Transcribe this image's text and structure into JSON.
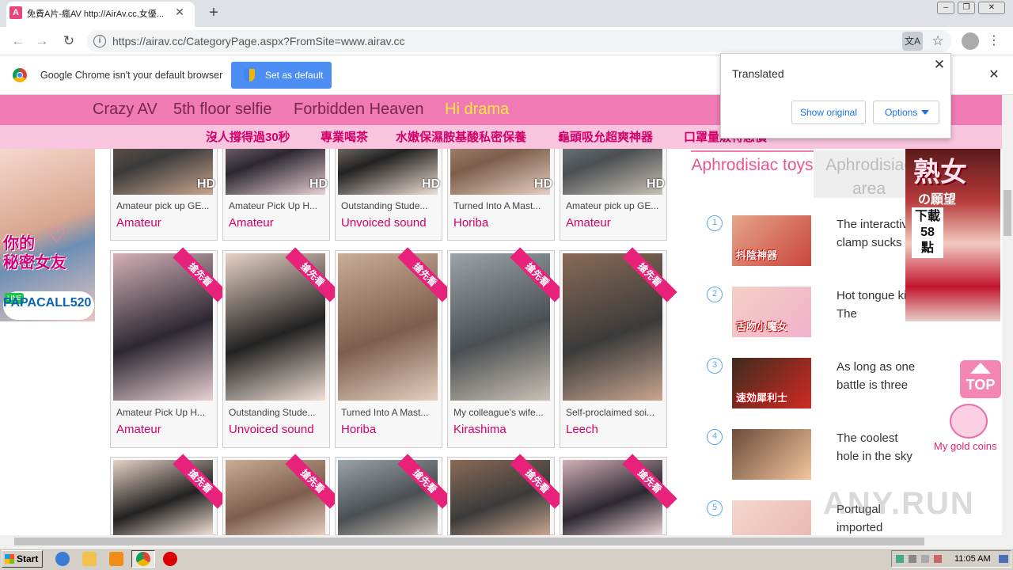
{
  "browser": {
    "tab_title": "免費A片-瘋AV http://AirAv.cc,女優...",
    "favicon_letter": "A",
    "url": "https://airav.cc/CategoryPage.aspx?FromSite=www.airav.cc",
    "infobar_text": "Google Chrome isn't your default browser",
    "set_default_label": "Set as default"
  },
  "translate_popup": {
    "title": "Translated",
    "show_original": "Show original",
    "options": "Options"
  },
  "nav_primary": [
    {
      "label": "Crazy AV"
    },
    {
      "label": "5th floor selfie"
    },
    {
      "label": "Forbidden Heaven"
    },
    {
      "label": "Hi drama"
    }
  ],
  "nav_secondary": [
    {
      "label": "沒人撐得過30秒"
    },
    {
      "label": "專業喝茶"
    },
    {
      "label": "水嫩保濕胺基酸私密保養"
    },
    {
      "label": "龜頭吸允超爽神器"
    },
    {
      "label": "口罩量販特惠價"
    }
  ],
  "left_ad": {
    "text": "你的\n秘密女友",
    "line_id": "PAPACALL520",
    "line_logo": "LINE"
  },
  "cards_row1": [
    {
      "title": "Amateur pick up GE...",
      "category": "Amateur",
      "badge": "HD"
    },
    {
      "title": "Amateur Pick Up H...",
      "category": "Amateur",
      "badge": "HD"
    },
    {
      "title": "Outstanding Stude...",
      "category": "Unvoiced sound",
      "badge": "HD"
    },
    {
      "title": "Turned Into A Mast...",
      "category": "Horiba",
      "badge": "HD"
    },
    {
      "title": "Amateur pick up GE...",
      "category": "Amateur",
      "badge": "HD"
    }
  ],
  "cards_row2": [
    {
      "title": "Amateur Pick Up H...",
      "category": "Amateur",
      "ribbon": "搶先看"
    },
    {
      "title": "Outstanding Stude...",
      "category": "Unvoiced sound",
      "ribbon": "搶先看"
    },
    {
      "title": "Turned Into A Mast...",
      "category": "Horiba",
      "ribbon": "搶先看"
    },
    {
      "title": "My colleague's wife...",
      "category": "Kirashima",
      "ribbon": "搶先看"
    },
    {
      "title": "Self-proclaimed soi...",
      "category": "Leech",
      "ribbon": "搶先看"
    }
  ],
  "cards_row3": [
    {
      "ribbon": "搶先看"
    },
    {
      "ribbon": "搶先看"
    },
    {
      "ribbon": "搶先看"
    },
    {
      "ribbon": "搶先看"
    },
    {
      "ribbon": "搶先看"
    }
  ],
  "sidebar": {
    "tab_active": "Aphrodisiac toys",
    "tab_inactive": "Aphrodisiac area",
    "items": [
      {
        "rank": "1",
        "text": "The interactive clamp sucks",
        "thumb_text": "抖陰神器"
      },
      {
        "rank": "2",
        "text": "Hot tongue kiss! The",
        "thumb_text": "舌吻小魔女"
      },
      {
        "rank": "3",
        "text": "As long as one battle is three",
        "thumb_text": "速効犀利士"
      },
      {
        "rank": "4",
        "text": "The coolest hole in the sky",
        "thumb_text": ""
      },
      {
        "rank": "5",
        "text": "Portugal imported",
        "thumb_text": ""
      }
    ]
  },
  "right_ad": {
    "title": "熟女",
    "subtitle": "の願望",
    "download": "下載\n58\n點"
  },
  "top_button": "TOP",
  "coins_label": "My gold coins",
  "watermark": "ANY.RUN",
  "taskbar": {
    "start": "Start",
    "clock": "11:05 AM"
  }
}
